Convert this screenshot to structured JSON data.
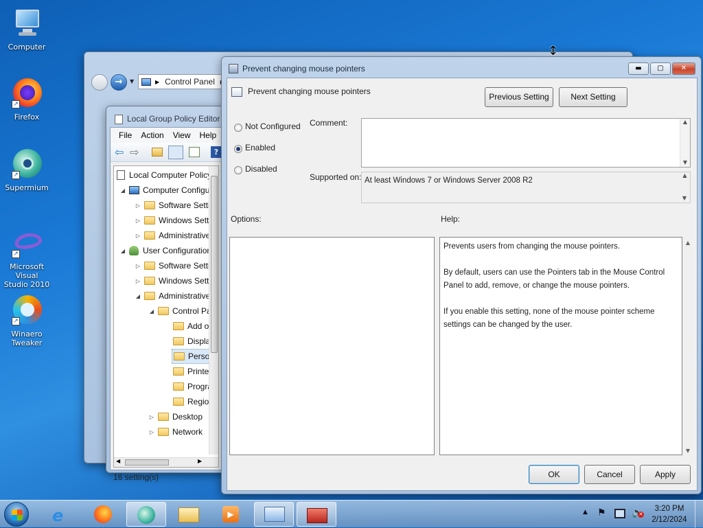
{
  "desktop": {
    "icons": [
      {
        "label": "Computer"
      },
      {
        "label": "Firefox"
      },
      {
        "label": "Supermium"
      },
      {
        "label_line1": "Microsoft Visual",
        "label_line2": "Studio 2010"
      },
      {
        "label_line1": "Winaero",
        "label_line2": "Tweaker"
      }
    ]
  },
  "explorer": {
    "address": "Control Panel"
  },
  "gpedit": {
    "title": "Local Group Policy Editor",
    "menu": [
      "File",
      "Action",
      "View",
      "Help"
    ],
    "tree": [
      {
        "label": "Local Computer Policy"
      },
      {
        "label": "Computer Configura"
      },
      {
        "label": "Software Settin"
      },
      {
        "label": "Windows Settin"
      },
      {
        "label": "Administrative"
      },
      {
        "label": "User Configuration"
      },
      {
        "label": "Software Settin"
      },
      {
        "label": "Windows Settin"
      },
      {
        "label": "Administrative"
      },
      {
        "label": "Control Pa"
      },
      {
        "label": "Add o"
      },
      {
        "label": "Displa"
      },
      {
        "label": "Perso"
      },
      {
        "label": "Printe"
      },
      {
        "label": "Progra"
      },
      {
        "label": "Regio"
      },
      {
        "label": "Desktop"
      },
      {
        "label": "Network"
      }
    ],
    "status": "16 setting(s)"
  },
  "dialog": {
    "title": "Prevent changing mouse pointers",
    "heading": "Prevent changing mouse pointers",
    "prev_button": "Previous Setting",
    "next_button": "Next Setting",
    "radio_not_configured": "Not Configured",
    "radio_enabled": "Enabled",
    "radio_disabled": "Disabled",
    "selected": "Enabled",
    "comment_label": "Comment:",
    "comment_value": "",
    "supported_label": "Supported on:",
    "supported_value": "At least Windows 7 or Windows Server 2008 R2",
    "options_label": "Options:",
    "help_label": "Help:",
    "help_p1": "Prevents users from changing the mouse pointers.",
    "help_p2": "By default, users can use the Pointers tab in the Mouse Control Panel to add, remove, or change the mouse pointers.",
    "help_p3": "If you enable this setting, none of the mouse pointer scheme settings can be changed by the user.",
    "ok": "OK",
    "cancel": "Cancel",
    "apply": "Apply"
  },
  "taskbar": {
    "time": "3:20 PM",
    "date": "2/12/2024"
  }
}
